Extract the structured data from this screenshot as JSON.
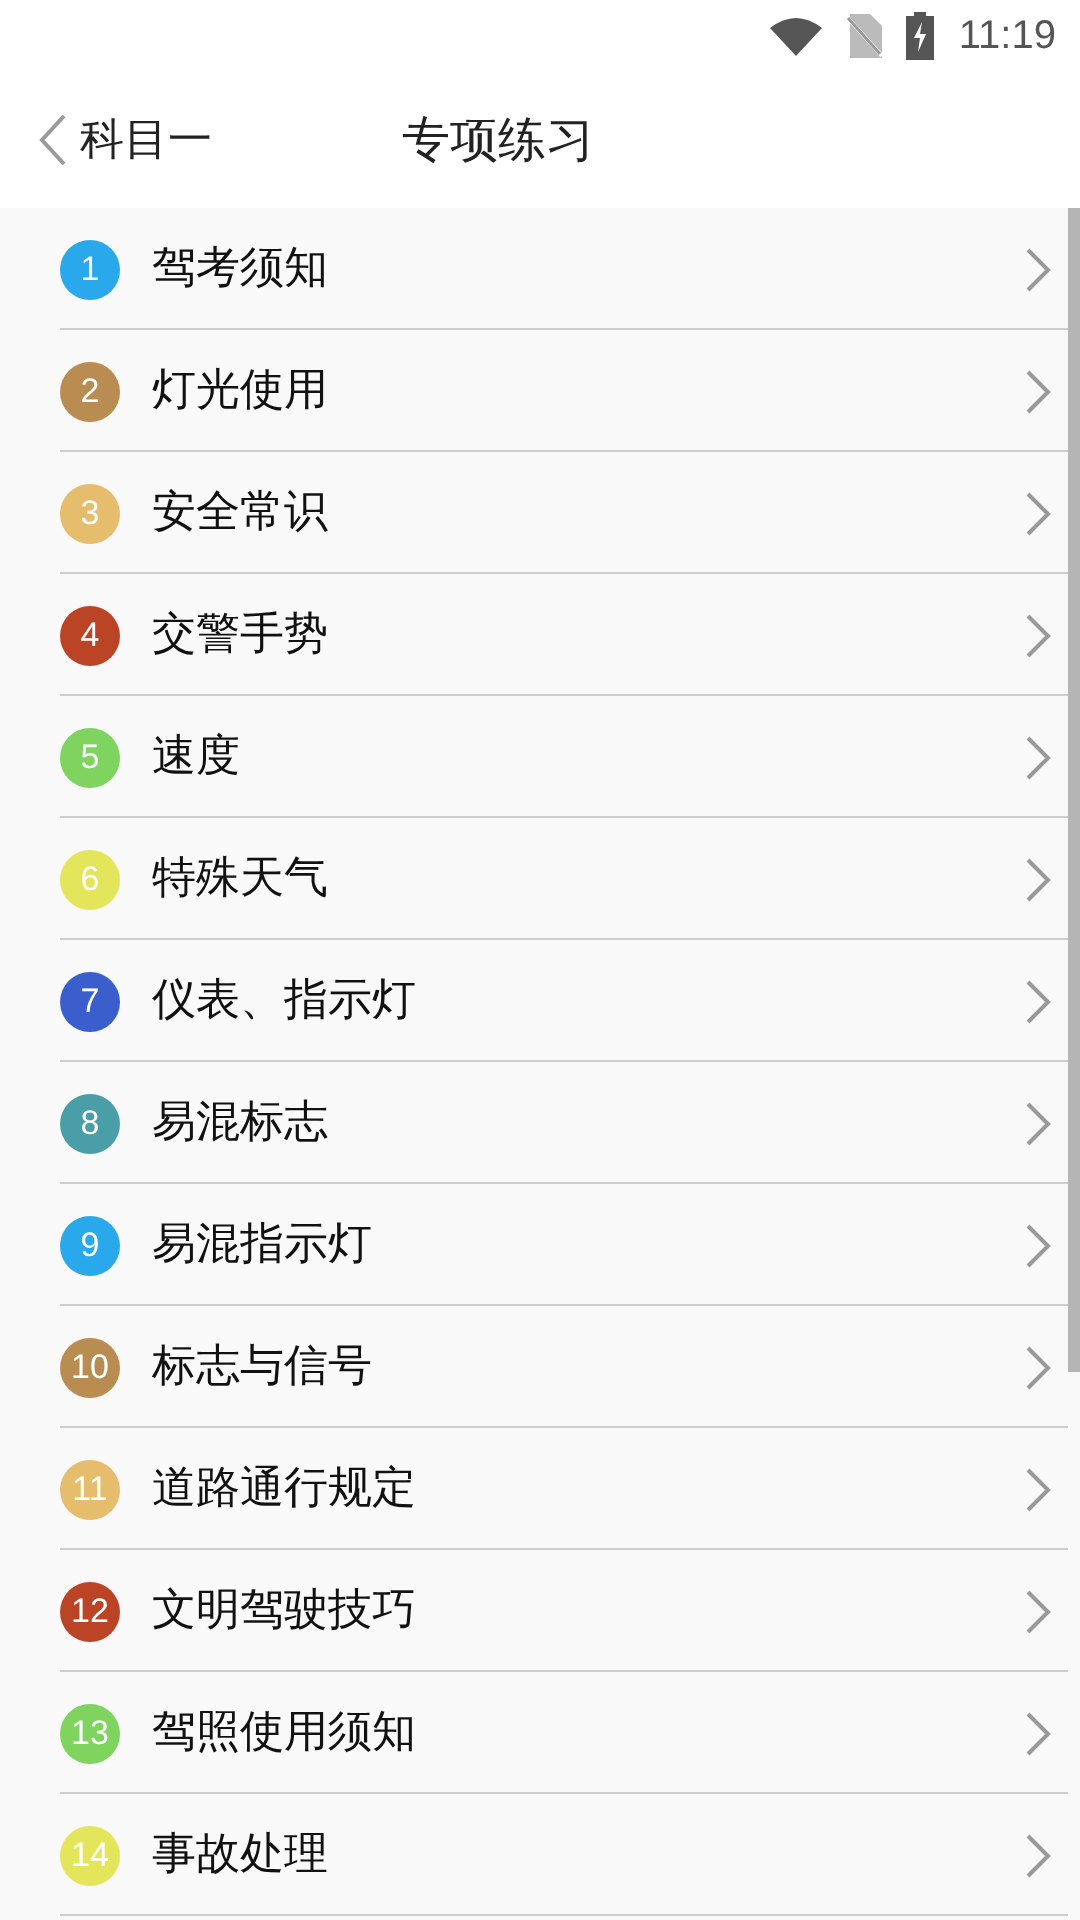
{
  "status_bar": {
    "time": "11:19"
  },
  "header": {
    "back_label": "科目一",
    "title": "专项练习"
  },
  "items": [
    {
      "number": "1",
      "label": "驾考须知",
      "color": "#29a8ec"
    },
    {
      "number": "2",
      "label": "灯光使用",
      "color": "#b98d52"
    },
    {
      "number": "3",
      "label": "安全常识",
      "color": "#e6bd6c"
    },
    {
      "number": "4",
      "label": "交警手势",
      "color": "#bb4427"
    },
    {
      "number": "5",
      "label": "速度",
      "color": "#7ed45f"
    },
    {
      "number": "6",
      "label": "特殊天气",
      "color": "#e3e65a"
    },
    {
      "number": "7",
      "label": "仪表、指示灯",
      "color": "#3a5fcd"
    },
    {
      "number": "8",
      "label": "易混标志",
      "color": "#4a9ea8"
    },
    {
      "number": "9",
      "label": "易混指示灯",
      "color": "#29a8ec"
    },
    {
      "number": "10",
      "label": "标志与信号",
      "color": "#b98d52"
    },
    {
      "number": "11",
      "label": "道路通行规定",
      "color": "#e6bd6c"
    },
    {
      "number": "12",
      "label": "文明驾驶技巧",
      "color": "#bb4427"
    },
    {
      "number": "13",
      "label": "驾照使用须知",
      "color": "#7ed45f"
    },
    {
      "number": "14",
      "label": "事故处理",
      "color": "#e3e65a"
    }
  ]
}
